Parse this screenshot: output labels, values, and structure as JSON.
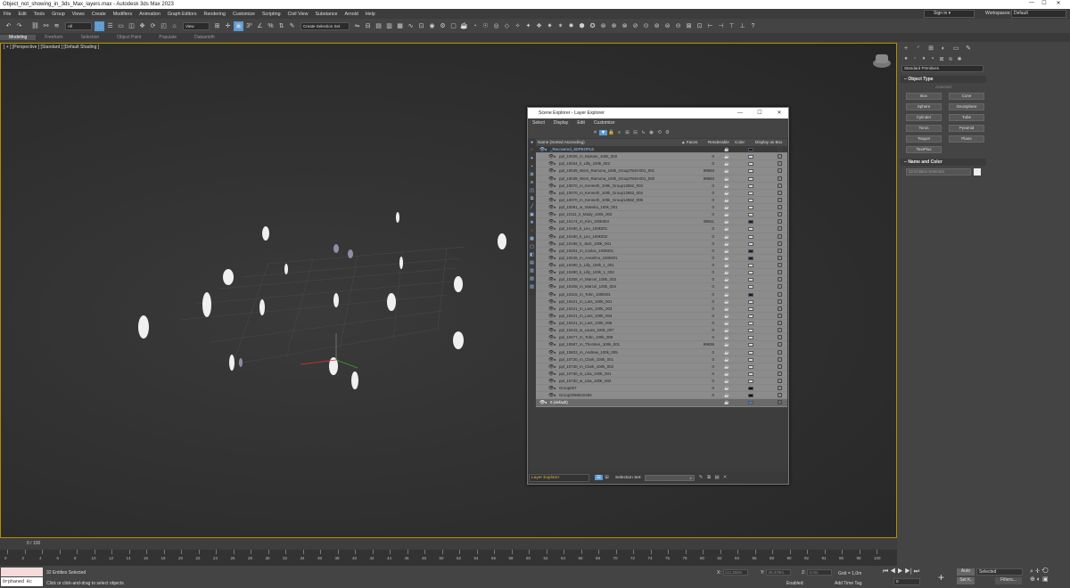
{
  "window": {
    "title": "Object_not_showing_in_3ds_Max_layers.max - Autodesk 3ds Max 2023",
    "minimize": "—",
    "maximize": "☐",
    "close": "✕"
  },
  "menu": [
    "File",
    "Edit",
    "Tools",
    "Group",
    "Views",
    "Create",
    "Modifiers",
    "Animation",
    "Graph Editors",
    "Rendering",
    "Customize",
    "Scripting",
    "Civil View",
    "Substance",
    "Arnold",
    "Help"
  ],
  "signin": "Sign in",
  "workspace": {
    "label": "Workspaces:",
    "value": "Default"
  },
  "toolbar": {
    "filter_select": "All",
    "view_select": "View",
    "selection_set": "Create Selection Set",
    "icons": [
      "undo-icon",
      "redo-icon",
      "link-icon",
      "unlink-icon",
      "bind-space-warp-icon"
    ]
  },
  "ribbon_tabs": [
    "Modeling",
    "Freeform",
    "Selection",
    "Object Paint",
    "Populate",
    "Datasmith"
  ],
  "viewport": {
    "label": "[ + ] [Perspective ] [Standard ] [Default Shading ]"
  },
  "command_panel": {
    "dropdown": "Standard Primitives",
    "object_type_title": "Object Type",
    "autogrid": "AutoGrid",
    "primitives": [
      "Box",
      "Cone",
      "Sphere",
      "GeoSphere",
      "Cylinder",
      "Tube",
      "Torus",
      "Pyramid",
      "Teapot",
      "Plane",
      "TextPlus"
    ],
    "name_color_title": "Name and Color",
    "name_placeholder": "32 Entities Selected"
  },
  "scene_explorer": {
    "title": "Scene Explorer - Layer Explorer",
    "menu": [
      "Select",
      "Display",
      "Edit",
      "Customize"
    ],
    "columns": {
      "name": "Name (Sorted Ascending)",
      "faces": "▲ Faces",
      "renderable": "Renderable",
      "color": "Color",
      "display_as_box": "Display as Box"
    },
    "layer": {
      "name": "_Recovered_3DPEOPLE"
    },
    "rows": [
      {
        "name": "ppl_10026_m_Myriam_100k_002",
        "faces": "0",
        "color": "#d8d8d8"
      },
      {
        "name": "ppl_10034_k_Lilly_100k_002",
        "faces": "0",
        "color": "#d8d8d8"
      },
      {
        "name": "ppl_10039_Wom_Ramona_100k_Group7843-001_001",
        "faces": "99953",
        "color": "#d8d8d8"
      },
      {
        "name": "ppl_10039_Wom_Ramona_100k_Group7843-001_002",
        "faces": "99953",
        "color": "#d8d8d8"
      },
      {
        "name": "ppl_10070_m_Kenneth_100k_Group12962_003",
        "faces": "0",
        "color": "#d8d8d8"
      },
      {
        "name": "ppl_10070_m_Kenneth_100k_Group12962_004",
        "faces": "0",
        "color": "#d8d8d8"
      },
      {
        "name": "ppl_10070_m_Kenneth_100k_Group12962_006",
        "faces": "0",
        "color": "#d8d8d8"
      },
      {
        "name": "ppl_10091_w_Valeska_100k_001",
        "faces": "0",
        "color": "#d8d8d8"
      },
      {
        "name": "ppl_10111_k_Mady_100k_002",
        "faces": "0",
        "color": "#d8d8d8"
      },
      {
        "name": "ppl_10174_m_Kim_100k003",
        "faces": "99911",
        "color": "#1a1a3a"
      },
      {
        "name": "ppl_10190_k_Leo_100k001",
        "faces": "0",
        "color": "#d8d8d8"
      },
      {
        "name": "ppl_10190_k_Leo_100k002",
        "faces": "0",
        "color": "#d8d8d8"
      },
      {
        "name": "ppl_10198_k_Jack_100k_001",
        "faces": "0",
        "color": "#d8d8d8"
      },
      {
        "name": "ppl_10204_m_Carlos_100k001",
        "faces": "0",
        "color": "#1a1a3a"
      },
      {
        "name": "ppl_10226_m_Anselmo_100k001",
        "faces": "0",
        "color": "#1a1a3a"
      },
      {
        "name": "ppl_10280_k_Lilly_100k_1_001",
        "faces": "0",
        "color": "#d8d8d8"
      },
      {
        "name": "ppl_10280_k_Lilly_100k_1_002",
        "faces": "0",
        "color": "#d8d8d8"
      },
      {
        "name": "ppl_10308_m_Marcel_100k_003",
        "faces": "0",
        "color": "#d8d8d8"
      },
      {
        "name": "ppl_10308_m_Marcel_100k_004",
        "faces": "0",
        "color": "#d8d8d8"
      },
      {
        "name": "ppl_10315_m_Tohn_100k001",
        "faces": "0",
        "color": "#1a1a3a"
      },
      {
        "name": "ppl_10421_m_Lars_100k_001",
        "faces": "0",
        "color": "#d8d8d8"
      },
      {
        "name": "ppl_10421_m_Lars_100k_003",
        "faces": "0",
        "color": "#d8d8d8"
      },
      {
        "name": "ppl_10421_m_Lars_100k_004",
        "faces": "0",
        "color": "#d8d8d8"
      },
      {
        "name": "ppl_10421_m_Lars_100k_005",
        "faces": "0",
        "color": "#d8d8d8"
      },
      {
        "name": "ppl_10443_w_Laura_100k_007",
        "faces": "0",
        "color": "#d8d8d8"
      },
      {
        "name": "ppl_10477_m_Tohn_100k_008",
        "faces": "0",
        "color": "#d8d8d8"
      },
      {
        "name": "ppl_10587_m_Thorsten_100k_001",
        "faces": "99836",
        "color": "#d8d8d8"
      },
      {
        "name": "ppl_10603_m_Andrew_100k_005",
        "faces": "0",
        "color": "#d8d8d8"
      },
      {
        "name": "ppl_10730_m_Clark_100k_001",
        "faces": "0",
        "color": "#d8d8d8"
      },
      {
        "name": "ppl_10730_m_Clark_100k_002",
        "faces": "0",
        "color": "#d8d8d8"
      },
      {
        "name": "ppl_10730_w_Lisa_100k_001",
        "faces": "0",
        "color": "#d8d8d8"
      },
      {
        "name": "ppl_10730_w_Lisa_100k_002",
        "faces": "0",
        "color": "#d8d8d8"
      },
      {
        "name": "Group007",
        "faces": "0",
        "color": "#111111"
      },
      {
        "name": "Group2069532450",
        "faces": "0",
        "color": "#111111"
      }
    ],
    "default_layer": {
      "name": "0 (default)",
      "color": "#3b7dd8"
    },
    "footer": {
      "explorer": "Layer Explorer",
      "selection_set_label": "Selection Set:"
    }
  },
  "timeline": {
    "slider": "0 / 100",
    "ticks": [
      "0",
      "2",
      "4",
      "6",
      "8",
      "10",
      "12",
      "14",
      "16",
      "18",
      "20",
      "22",
      "24",
      "26",
      "28",
      "30",
      "32",
      "34",
      "36",
      "38",
      "40",
      "42",
      "44",
      "46",
      "48",
      "50",
      "52",
      "54",
      "56",
      "58",
      "60",
      "62",
      "64",
      "66",
      "68",
      "70",
      "72",
      "74",
      "76",
      "78",
      "80",
      "82",
      "84",
      "86",
      "88",
      "90",
      "92",
      "94",
      "96",
      "98",
      "100"
    ]
  },
  "status": {
    "maxscript_line": "Orphaned Kc",
    "entities": "32 Entities Selected",
    "prompt": "Click or click-and-drag to select objects",
    "x_label": "X:",
    "x_value": "112,359m",
    "y_label": "Y:",
    "y_value": "25,379m",
    "z_label": "Z:",
    "z_value": "0,0m",
    "grid": "Grid = 1,0m",
    "enabled": "Enabled:",
    "add_time_tag": "Add Time Tag",
    "auto": "Auto",
    "setk": "Set K.",
    "selected": "Selected",
    "filters": "Filters...",
    "frame": "0"
  }
}
